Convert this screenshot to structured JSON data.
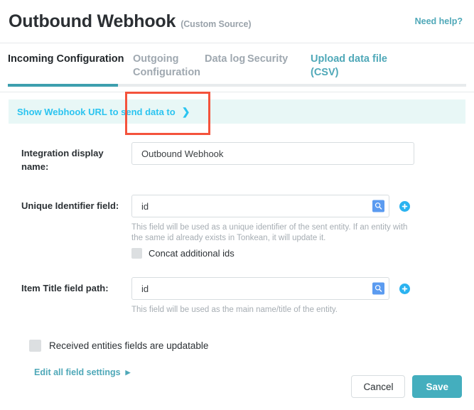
{
  "header": {
    "title": "Outbound Webhook",
    "subtitle": "(Custom Source)",
    "need_help": "Need help?"
  },
  "tabs": [
    {
      "label": "Incoming Configuration",
      "active": true
    },
    {
      "label": "Outgoing Configuration",
      "active": false,
      "annotated": true
    },
    {
      "label": "Data log",
      "active": false
    },
    {
      "label": "Security",
      "active": false
    },
    {
      "label": "Upload data file (CSV)",
      "active": false
    }
  ],
  "banner": {
    "label": "Show Webhook URL to send data to",
    "chevron": "chevron-right-icon"
  },
  "form": {
    "display_name": {
      "label": "Integration display name:",
      "value": "Outbound Webhook",
      "placeholder": ""
    },
    "unique_identifier": {
      "label": "Unique Identifier field:",
      "value": "id",
      "placeholder": "",
      "helper": "This field will be used as a unique identifier of the sent entity. If an entity with the same id already exists in Tonkean, it will update it.",
      "checkbox_label": "Concat additional ids",
      "checkbox_checked": false,
      "search_icon": "search-icon",
      "add_icon": "plus-circle-icon"
    },
    "item_title": {
      "label": "Item Title field path:",
      "value": "id",
      "placeholder": "",
      "helper": "This field will be used as the main name/title of the entity.",
      "search_icon": "search-icon",
      "add_icon": "plus-circle-icon"
    },
    "updatable": {
      "label": "Received entities fields are updatable",
      "checked": false
    },
    "edit_all": {
      "label": "Edit all field settings",
      "arrow": "triangle-right-icon"
    }
  },
  "footer": {
    "cancel": "Cancel",
    "save": "Save"
  },
  "colors": {
    "teal": "#44aebe",
    "cyan": "#2bc4f0",
    "annotation_red": "#f4533c",
    "banner_bg": "#e8f7f6"
  }
}
